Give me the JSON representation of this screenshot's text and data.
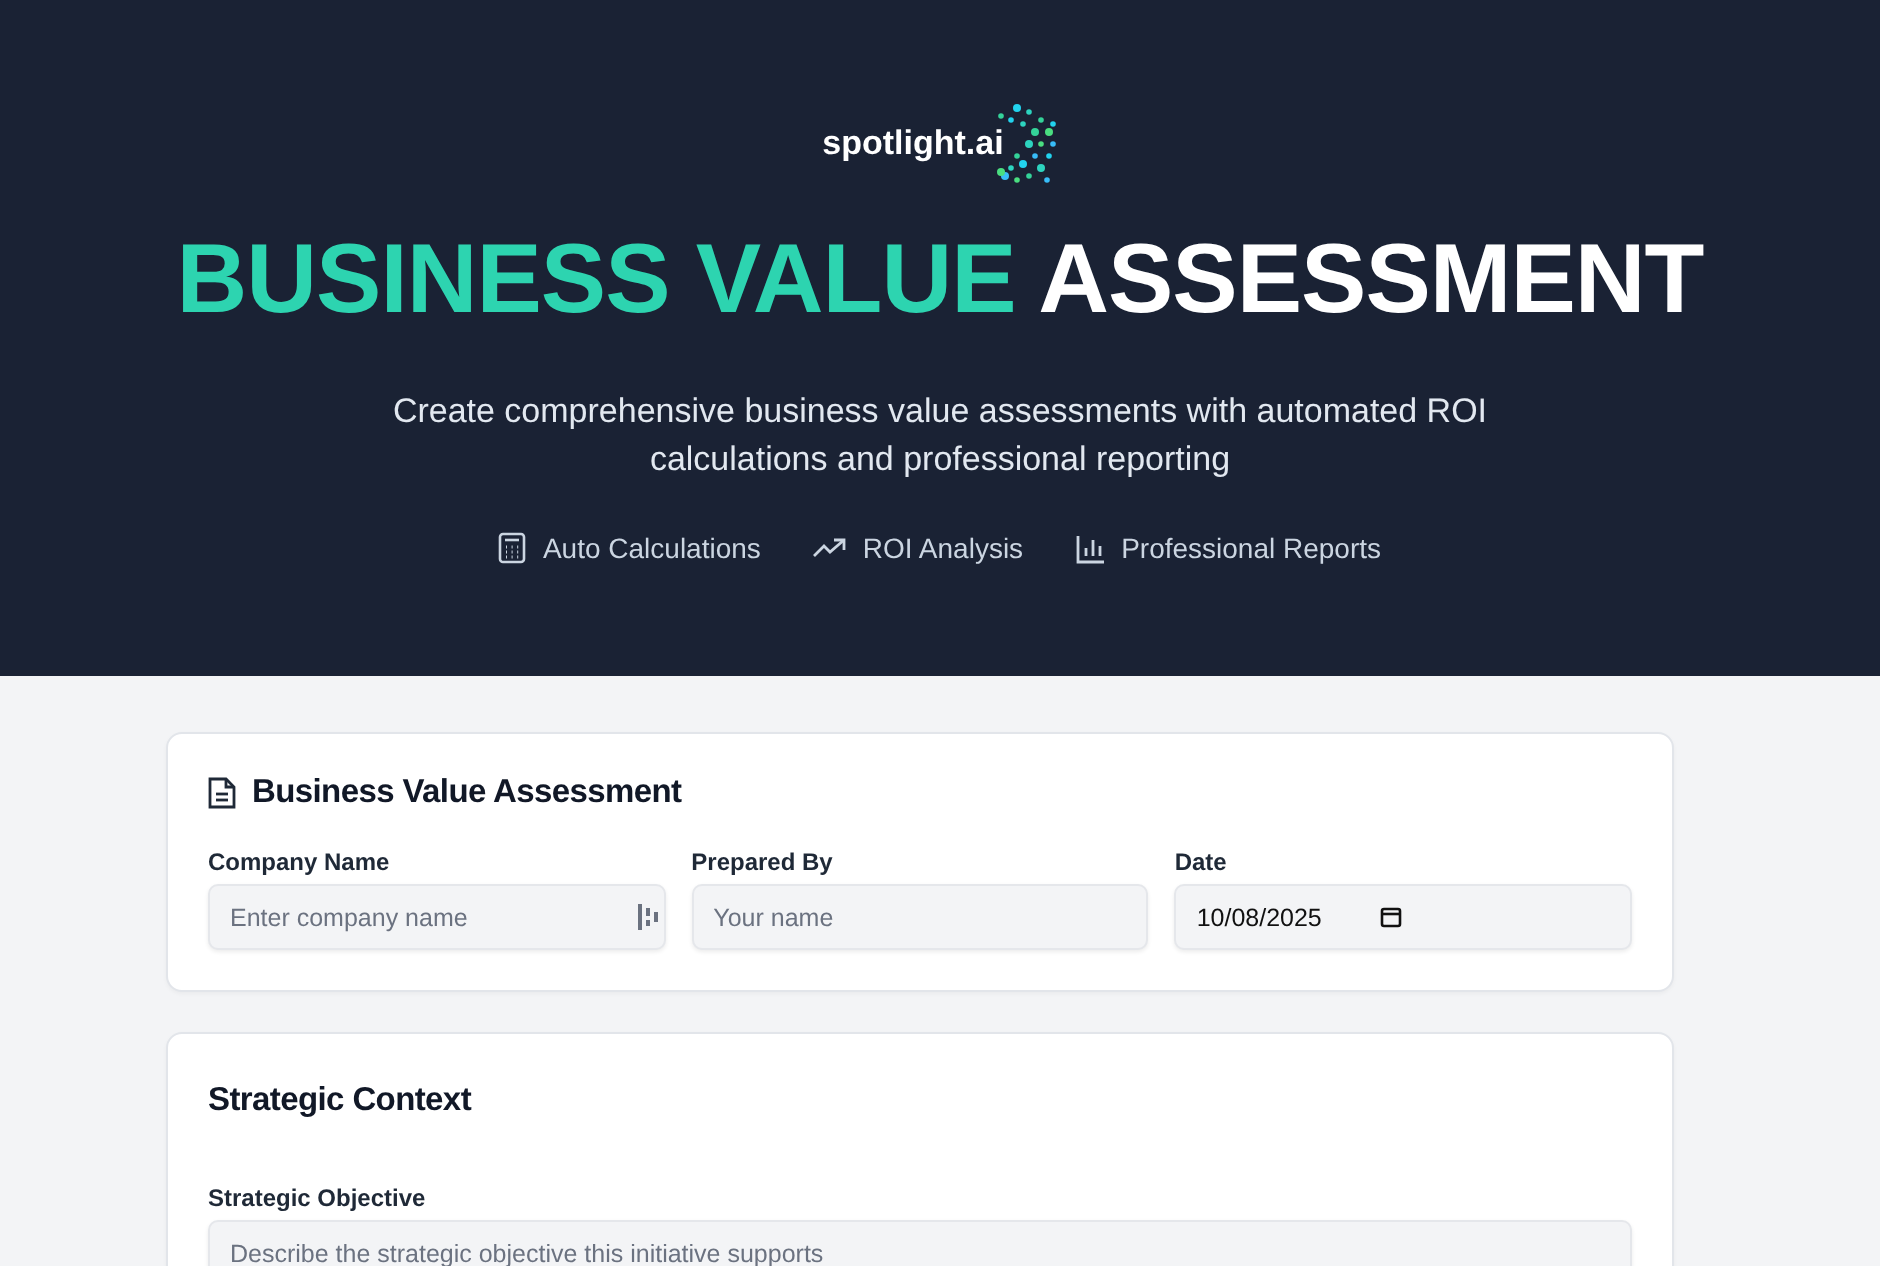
{
  "hero": {
    "logo": {
      "text": "spotlight.ai"
    },
    "title_highlight": "BUSINESS VALUE",
    "title_rest": "ASSESSMENT",
    "subtitle": "Create comprehensive business value assessments with automated ROI calculations and professional reporting",
    "features": [
      {
        "kind": "calculator",
        "label": "Auto Calculations"
      },
      {
        "kind": "trend",
        "label": "ROI Analysis"
      },
      {
        "kind": "chart",
        "label": "Professional Reports"
      }
    ]
  },
  "cards": [
    {
      "title": "Business Value Assessment",
      "icon": true,
      "fields": [
        {
          "kind": "text",
          "label": "Company Name",
          "placeholder": "Enter company name",
          "autofill_icon": true
        },
        {
          "kind": "text",
          "label": "Prepared By",
          "placeholder": "Your name",
          "autofill_icon": false
        },
        {
          "kind": "date",
          "label": "Date",
          "value": "10/08/2025",
          "autofill_icon": false
        }
      ]
    },
    {
      "title": "Strategic Context",
      "icon": false,
      "fields": [
        {
          "kind": "text",
          "label": "Strategic Objective",
          "placeholder": "Describe the strategic objective this initiative supports",
          "autofill_icon": false
        }
      ]
    }
  ]
}
